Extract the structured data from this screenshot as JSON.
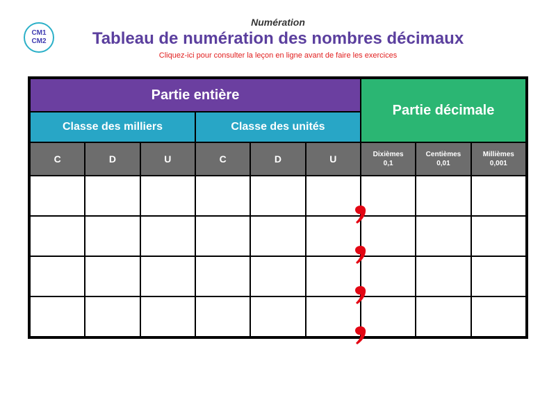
{
  "badge": {
    "line1": "CM1",
    "line2": "CM2"
  },
  "header": {
    "supertitle": "Numération",
    "title": "Tableau de numération des nombres décimaux",
    "subtitle": "Cliquez-ici pour consulter la leçon en ligne avant de faire les exercices"
  },
  "sections": {
    "integer": "Partie entière",
    "decimal": "Partie décimale",
    "thousands": "Classe des milliers",
    "units": "Classe des unités"
  },
  "cols": {
    "c": "C",
    "d": "D",
    "u": "U",
    "tenths_label": "Dixièmes",
    "tenths_val": "0,1",
    "hundredths_label": "Centièmes",
    "hundredths_val": "0,01",
    "thousandths_label": "Millièmes",
    "thousandths_val": "0,001"
  }
}
